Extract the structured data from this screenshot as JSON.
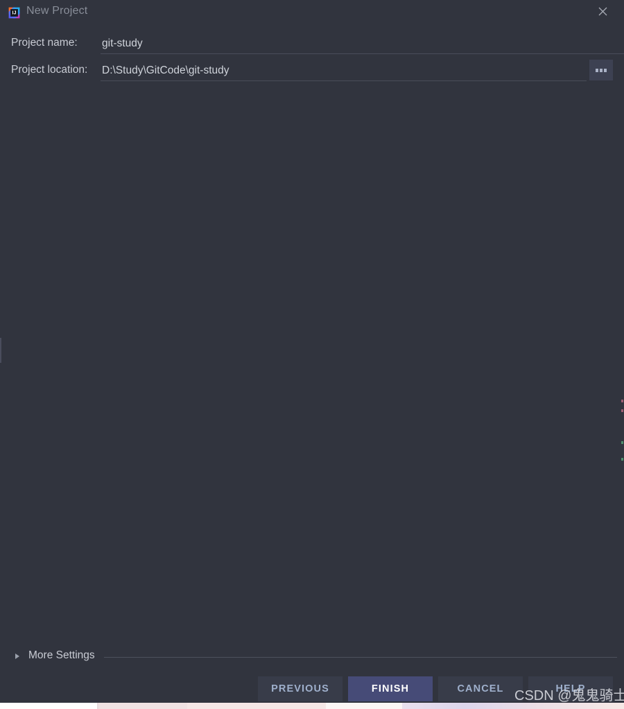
{
  "window": {
    "title": "New Project",
    "app_icon": "intellij-idea-logo-icon",
    "close_icon": "close-icon"
  },
  "form": {
    "fields": [
      {
        "label": "Project name:",
        "value": "git-study",
        "placeholder": "",
        "name": "project-name"
      },
      {
        "label": "Project location:",
        "value": "D:\\Study\\GitCode\\git-study",
        "placeholder": "",
        "name": "project-location"
      }
    ],
    "browse_button": {
      "label": "...",
      "icon": "ellipsis-icon"
    }
  },
  "more_settings": {
    "label": "More Settings",
    "expand_icon": "chevron-right-icon",
    "expanded": false
  },
  "footer": {
    "buttons": [
      {
        "label": "PREVIOUS",
        "name": "previous",
        "primary": false
      },
      {
        "label": "FINISH",
        "name": "finish",
        "primary": true
      },
      {
        "label": "CANCEL",
        "name": "cancel",
        "primary": false
      },
      {
        "label": "HELP",
        "name": "help",
        "primary": false
      }
    ]
  },
  "watermark": {
    "text": "CSDN @鬼鬼骑士"
  },
  "colors": {
    "dialog_background": "#31343e",
    "field_underline": "#4a4e5a",
    "button_background": "#383c49",
    "button_text": "#9fb0cc",
    "primary_button_background": "#464b77",
    "primary_button_text": "#ffffff",
    "label_text": "#c9ccd4",
    "title_text": "#898e99",
    "browse_button_background": "#3d4152"
  }
}
